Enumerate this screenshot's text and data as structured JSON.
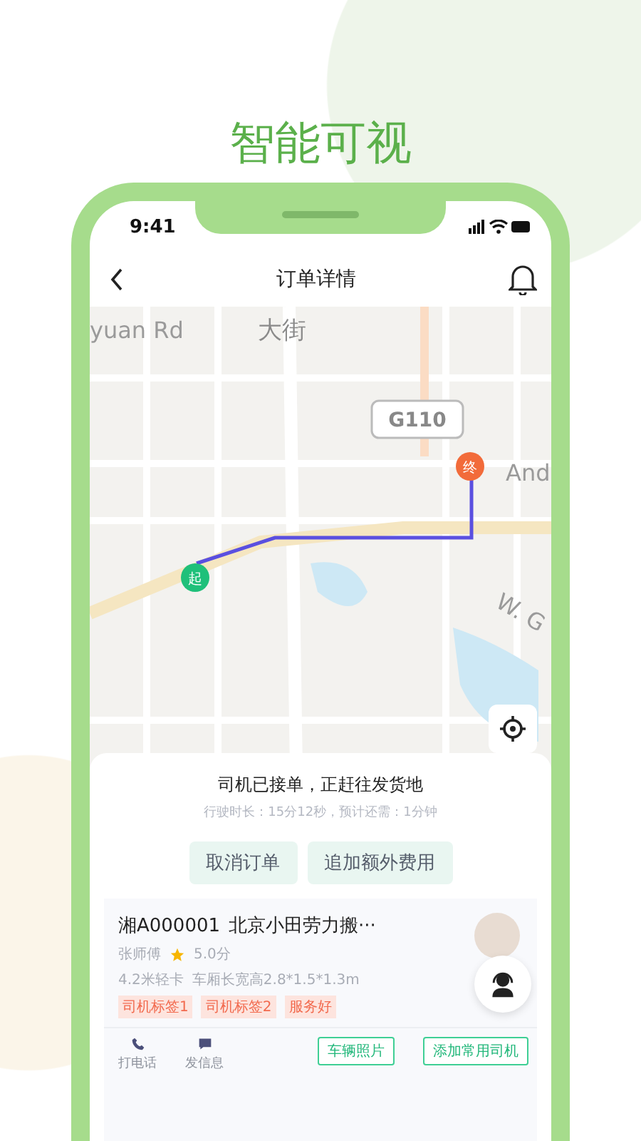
{
  "headline": "智能可视",
  "status_bar": {
    "time": "9:41"
  },
  "nav": {
    "title": "订单详情"
  },
  "map": {
    "labels": [
      "yuan Rd",
      "大街",
      "G110",
      "And",
      "W. G"
    ],
    "start_marker": "起",
    "end_marker": "终"
  },
  "order_status": {
    "title": "司机已接单，正赶往发货地",
    "subtitle": "行驶时长：15分12秒，预计还需：1分钟"
  },
  "order_actions": [
    "取消订单",
    "追加额外费用"
  ],
  "driver": {
    "plate": "湘A000001",
    "company": "北京小田劳力搬···",
    "name": "张师傅",
    "rating": "5.0分",
    "vehicle": "4.2米轻卡",
    "cargo_size": "车厢长宽高2.8*1.5*1.3m",
    "tags": [
      "司机标签1",
      "司机标签2",
      "服务好"
    ]
  },
  "contact_actions": [
    {
      "kind": "phone",
      "label": "打电话"
    },
    {
      "kind": "message",
      "label": "发信息"
    }
  ],
  "driver_buttons": [
    "车辆照片",
    "添加常用司机"
  ]
}
